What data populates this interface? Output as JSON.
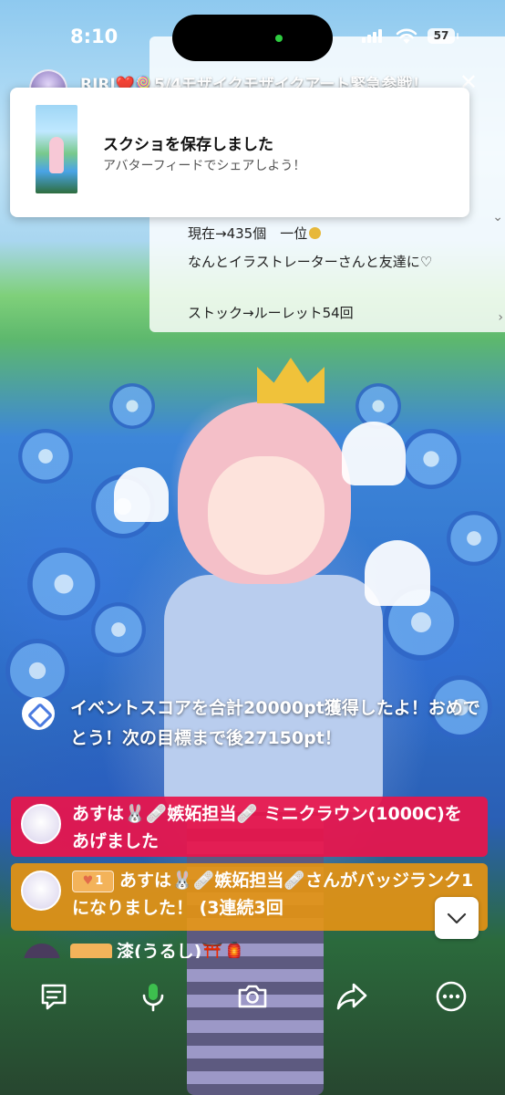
{
  "status_bar": {
    "time": "8:10",
    "battery": "57"
  },
  "stream": {
    "title": "RIRI❤️🍭5/4モザイクモザイクアート緊急参戦！",
    "description_lines": [
      "現在→435個　一位",
      "なんとイラストレーターさんと友達に♡",
      "ストック→ルーレット54回"
    ]
  },
  "toast": {
    "title": "スクショを保存しました",
    "subtitle": "アバターフィードでシェアしよう！"
  },
  "chat": {
    "event_message": "イベントスコアを合計20000pt獲得したよ！おめでとう！次の目標まで後27150pt！",
    "gift_message": "あすは🐰🩹嫉妬担当🩹 ミニクラウン(1000C)をあげました",
    "badge_rank_label": "1",
    "badge_message": "あすは🐰🩹嫉妬担当🩹さんがバッジランク1になりました！ (3連続3回",
    "next_message_preview": "漆(うるし)⛩️🏮"
  },
  "toolbar": {
    "icons": [
      "comment-icon",
      "microphone-icon",
      "camera-icon",
      "share-icon",
      "more-icon"
    ]
  },
  "colors": {
    "gift_bg": "#E8144B",
    "badge_bg": "#E29214",
    "mic_green": "#3DBF4E"
  }
}
